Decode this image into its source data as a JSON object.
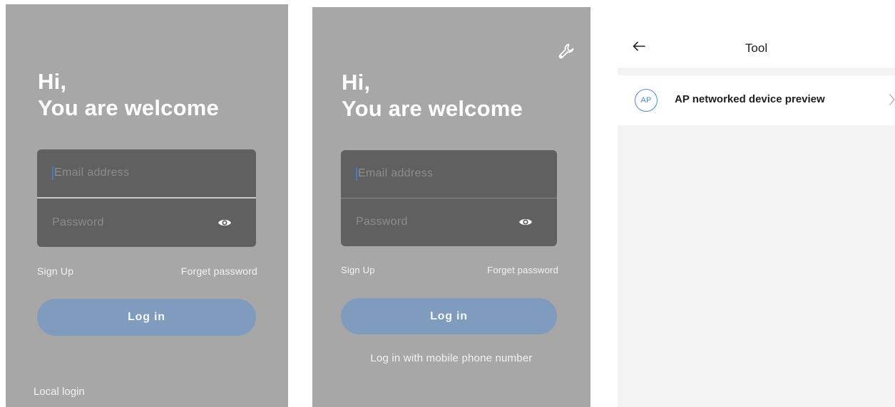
{
  "screens": [
    {
      "greeting_line1": "Hi,",
      "greeting_line2": "You are welcome",
      "email_placeholder": "Email address",
      "password_placeholder": "Password",
      "sign_up": "Sign Up",
      "forget_password": "Forget password",
      "login_button": "Log in",
      "local_login": "Local login"
    },
    {
      "greeting_line1": "Hi,",
      "greeting_line2": "You are welcome",
      "email_placeholder": "Email address",
      "password_placeholder": "Password",
      "sign_up": "Sign Up",
      "forget_password": "Forget password",
      "login_button": "Log in",
      "mobile_login": "Log in with mobile phone number"
    }
  ],
  "tool": {
    "title": "Tool",
    "items": [
      {
        "badge": "AP",
        "label": "AP networked device preview"
      }
    ]
  },
  "icons": {
    "eye": "eye-icon",
    "wrench": "wrench-icon",
    "back": "arrow-left-icon",
    "chevron": "chevron-right-icon"
  },
  "colors": {
    "panel_bg": "#a7a7a7",
    "field_bg": "#606060",
    "login_button": "#7f9bbd",
    "accent_blue": "#4a88e0"
  }
}
